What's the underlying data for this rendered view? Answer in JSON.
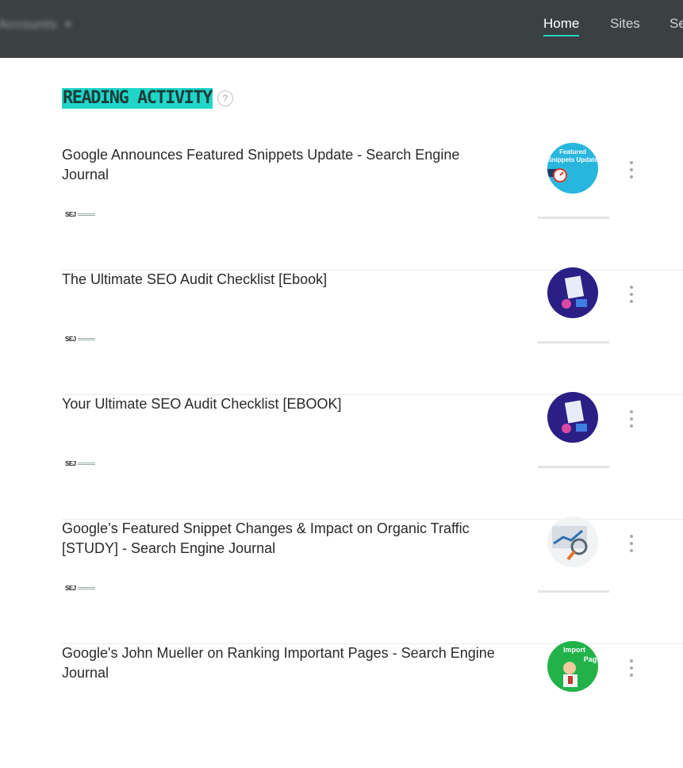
{
  "topbar": {
    "account": {
      "name": "Accounts",
      "caret_icon": "chevron-down-icon"
    },
    "tabs": [
      {
        "label": "Home",
        "active": true
      },
      {
        "label": "Sites",
        "active": false
      },
      {
        "label": "Se",
        "active": false
      }
    ],
    "accent_color": "#22d3c5"
  },
  "section": {
    "title": "READING ACTIVITY",
    "help_icon": "?"
  },
  "items": [
    {
      "title": "Google Announces Featured Snippets Update - Search Engine Journal",
      "source_logo": "SEJ",
      "thumb": "featured-snippets-thumb"
    },
    {
      "title": "The Ultimate SEO Audit Checklist [Ebook]",
      "source_logo": "SEJ",
      "thumb": "seo-audit-thumb"
    },
    {
      "title": "Your Ultimate SEO Audit Checklist [EBOOK]",
      "source_logo": "SEJ",
      "thumb": "seo-audit-thumb"
    },
    {
      "title": "Google’s Featured Snippet Changes & Impact on Organic Traffic [STUDY] - Search Engine Journal",
      "source_logo": "SEJ",
      "thumb": "organic-traffic-thumb"
    },
    {
      "title": "Google's John Mueller on Ranking Important Pages - Search Engine Journal",
      "source_logo": "SEJ",
      "thumb": "important-pages-thumb"
    }
  ]
}
